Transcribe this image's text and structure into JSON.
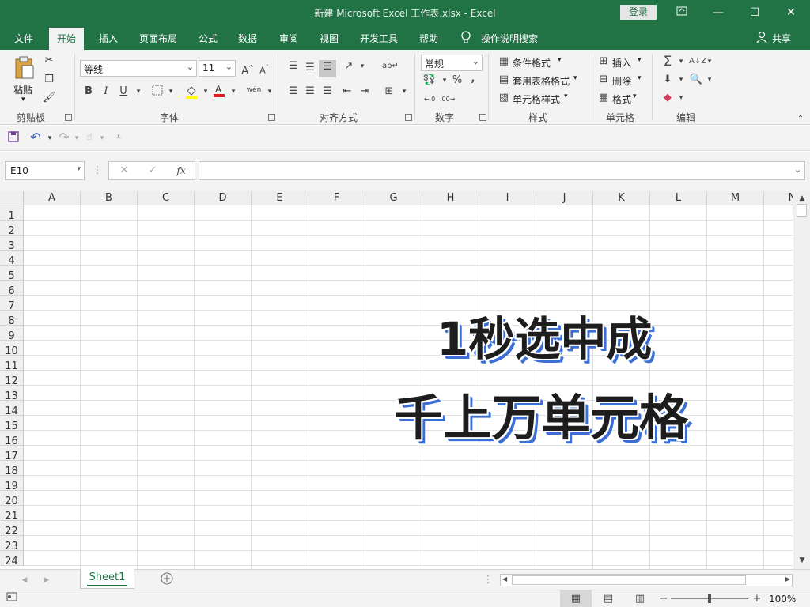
{
  "window": {
    "title": "新建 Microsoft Excel 工作表.xlsx  -  Excel",
    "login_label": "登录",
    "restore_icon": "ribbon-display-icon",
    "minimize_glyph": "—",
    "maximize_glyph": "☐",
    "close_glyph": "✕"
  },
  "tabs": [
    "文件",
    "开始",
    "插入",
    "页面布局",
    "公式",
    "数据",
    "审阅",
    "视图",
    "开发工具",
    "帮助"
  ],
  "active_tab": "开始",
  "tell_me": "操作说明搜索",
  "share": "共享",
  "ribbon": {
    "clipboard": {
      "paste": "粘贴",
      "label": "剪贴板"
    },
    "font": {
      "name": "等线",
      "size": "11",
      "label": "字体",
      "bold": "B",
      "italic": "I",
      "underline": "U",
      "wen": "wén"
    },
    "alignment": {
      "label": "对齐方式"
    },
    "number": {
      "format": "常规",
      "label": "数字",
      "percent": "%",
      "comma": ","
    },
    "styles": {
      "conditional": "条件格式",
      "table": "套用表格格式",
      "cell_styles": "单元格样式",
      "label": "样式"
    },
    "cells": {
      "insert": "插入",
      "delete": "删除",
      "format": "格式",
      "label": "单元格"
    },
    "editing": {
      "label": "编辑"
    }
  },
  "formula_bar": {
    "name_box": "E10",
    "cancel": "✕",
    "enter": "✓",
    "fx": "fx",
    "value": ""
  },
  "grid": {
    "columns": [
      "A",
      "B",
      "C",
      "D",
      "E",
      "F",
      "G",
      "H",
      "I",
      "J",
      "K",
      "L",
      "M",
      "N"
    ],
    "rows": [
      "1",
      "2",
      "3",
      "4",
      "5",
      "6",
      "7",
      "8",
      "9",
      "10",
      "11",
      "12",
      "13",
      "14",
      "15",
      "16",
      "17",
      "18",
      "19",
      "20",
      "21",
      "22",
      "23",
      "24"
    ]
  },
  "overlay": {
    "line1": "1秒选中成",
    "line2": "千上万单元格"
  },
  "sheets": [
    "Sheet1"
  ],
  "status": {
    "zoom": "100%"
  },
  "colors": {
    "accent": "#217346",
    "overlay_shadow": "#3b6fd6"
  }
}
